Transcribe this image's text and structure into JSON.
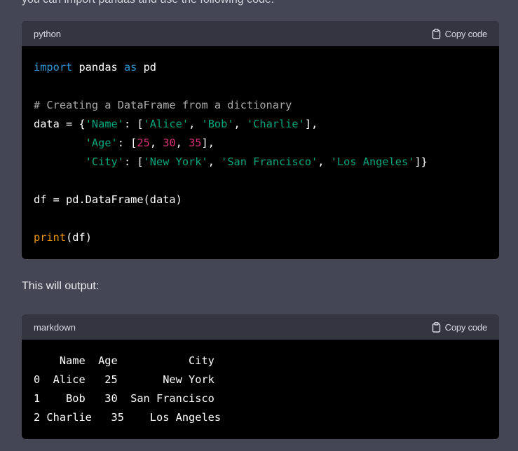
{
  "top_text": "you can import pandas and use the following code:",
  "block1": {
    "language": "python",
    "copy_label": "Copy code",
    "copy_icon": "clipboard-icon",
    "lines": [
      [
        {
          "t": "import",
          "c": "kw"
        },
        {
          "t": " pandas "
        },
        {
          "t": "as",
          "c": "kw"
        },
        {
          "t": " pd"
        }
      ],
      [],
      [
        {
          "t": "# Creating a DataFrame from a dictionary",
          "c": "cm"
        }
      ],
      [
        {
          "t": "data = {"
        },
        {
          "t": "'Name'",
          "c": "str"
        },
        {
          "t": ": ["
        },
        {
          "t": "'Alice'",
          "c": "str"
        },
        {
          "t": ", "
        },
        {
          "t": "'Bob'",
          "c": "str"
        },
        {
          "t": ", "
        },
        {
          "t": "'Charlie'",
          "c": "str"
        },
        {
          "t": "],"
        }
      ],
      [
        {
          "t": "        "
        },
        {
          "t": "'Age'",
          "c": "str"
        },
        {
          "t": ": ["
        },
        {
          "t": "25",
          "c": "num"
        },
        {
          "t": ", "
        },
        {
          "t": "30",
          "c": "num"
        },
        {
          "t": ", "
        },
        {
          "t": "35",
          "c": "num"
        },
        {
          "t": "],"
        }
      ],
      [
        {
          "t": "        "
        },
        {
          "t": "'City'",
          "c": "str"
        },
        {
          "t": ": ["
        },
        {
          "t": "'New York'",
          "c": "str"
        },
        {
          "t": ", "
        },
        {
          "t": "'San Francisco'",
          "c": "str"
        },
        {
          "t": ", "
        },
        {
          "t": "'Los Angeles'",
          "c": "str"
        },
        {
          "t": "]}"
        }
      ],
      [],
      [
        {
          "t": "df = pd.DataFrame(data)"
        }
      ],
      [],
      [
        {
          "t": "print",
          "c": "fn"
        },
        {
          "t": "(df)"
        }
      ]
    ]
  },
  "output_label": "This will output:",
  "block2": {
    "language": "markdown",
    "copy_label": "Copy code",
    "copy_icon": "clipboard-icon",
    "lines": [
      [
        {
          "t": "    Name  Age           City"
        }
      ],
      [
        {
          "t": "0  Alice   25       New York"
        }
      ],
      [
        {
          "t": "1    Bob   30  San Francisco"
        }
      ],
      [
        {
          "t": "2 Charlie   35    Los Angeles"
        }
      ]
    ]
  }
}
